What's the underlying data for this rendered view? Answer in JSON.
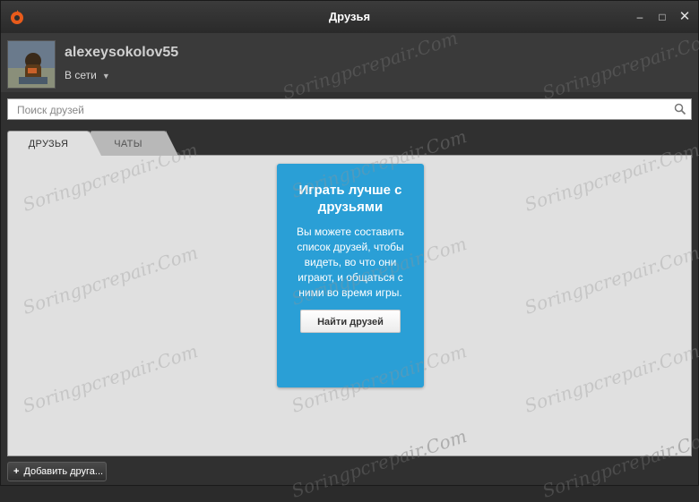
{
  "window": {
    "title": "Друзья",
    "controls": [
      "–",
      "□",
      "✕"
    ],
    "logo_icon": "origin-logo-icon",
    "accent_color": "#e85b1b"
  },
  "profile": {
    "username": "alexeysokolov55",
    "status": "В сети"
  },
  "search": {
    "placeholder": "Поиск друзей",
    "value": ""
  },
  "tabs": [
    {
      "label": "ДРУЗЬЯ",
      "active": true
    },
    {
      "label": "ЧАТЫ",
      "active": false
    }
  ],
  "card": {
    "title": "Играть лучше с друзьями",
    "text": "Вы можете составить список друзей, чтобы видеть, во что они играют, и общаться с ними во время игры.",
    "button": "Найти друзей",
    "color": "#2a9fd6"
  },
  "bottom": {
    "add_friend_label": "Добавить друга...",
    "plus": "+"
  },
  "watermark": "Soringpcrepair.Com"
}
